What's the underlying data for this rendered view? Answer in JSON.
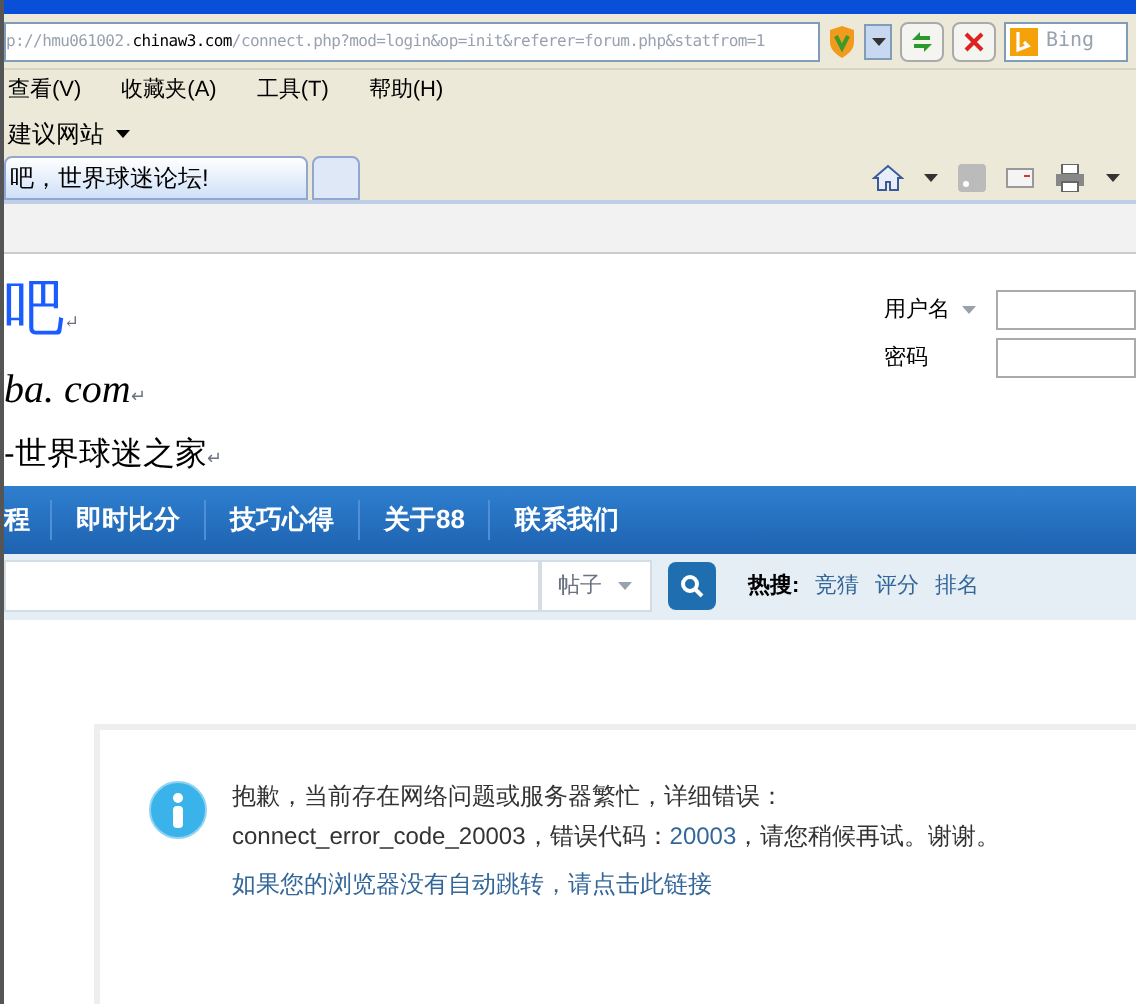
{
  "browser": {
    "address": {
      "prefix": "p://hmu061002.",
      "host": "chinaw3.com",
      "path": "/connect.php?mod=login&op=init&referer=forum.php&statfrom=1"
    },
    "search_placeholder": "Bing",
    "menu": [
      "查看(V)",
      "收藏夹(A)",
      "工具(T)",
      "帮助(H)"
    ],
    "favorites": [
      {
        "label": "建议网站",
        "has_menu": true
      }
    ],
    "tabs": [
      {
        "label": "吧，世界球迷论坛!",
        "selected": true
      },
      {
        "selected": false
      }
    ]
  },
  "site": {
    "logo": {
      "line_1": "吧",
      "line_2": "ba. com",
      "line_3": "-世界球迷之家",
      "mark": "↵"
    },
    "login": [
      {
        "label": "用户名",
        "has_menu": true
      },
      {
        "label": "密码",
        "has_menu": false
      }
    ],
    "nav": [
      "程",
      "即时比分",
      "技巧心得",
      "关于88",
      "联系我们"
    ],
    "search": {
      "scope": "帖子",
      "hot_label": "热搜:",
      "hot": [
        "竞猜",
        "评分",
        "排名"
      ]
    },
    "message": {
      "line_1": "抱歉，当前存在网络问题或服务器繁忙，详细错误：connect_error_code_20003，错误",
      "line_2_before": "代码：",
      "code": "20003",
      "line_2_after": "，请您稍候再试。谢谢。",
      "link": "如果您的浏览器没有自动跳转，请点击此链接"
    }
  }
}
